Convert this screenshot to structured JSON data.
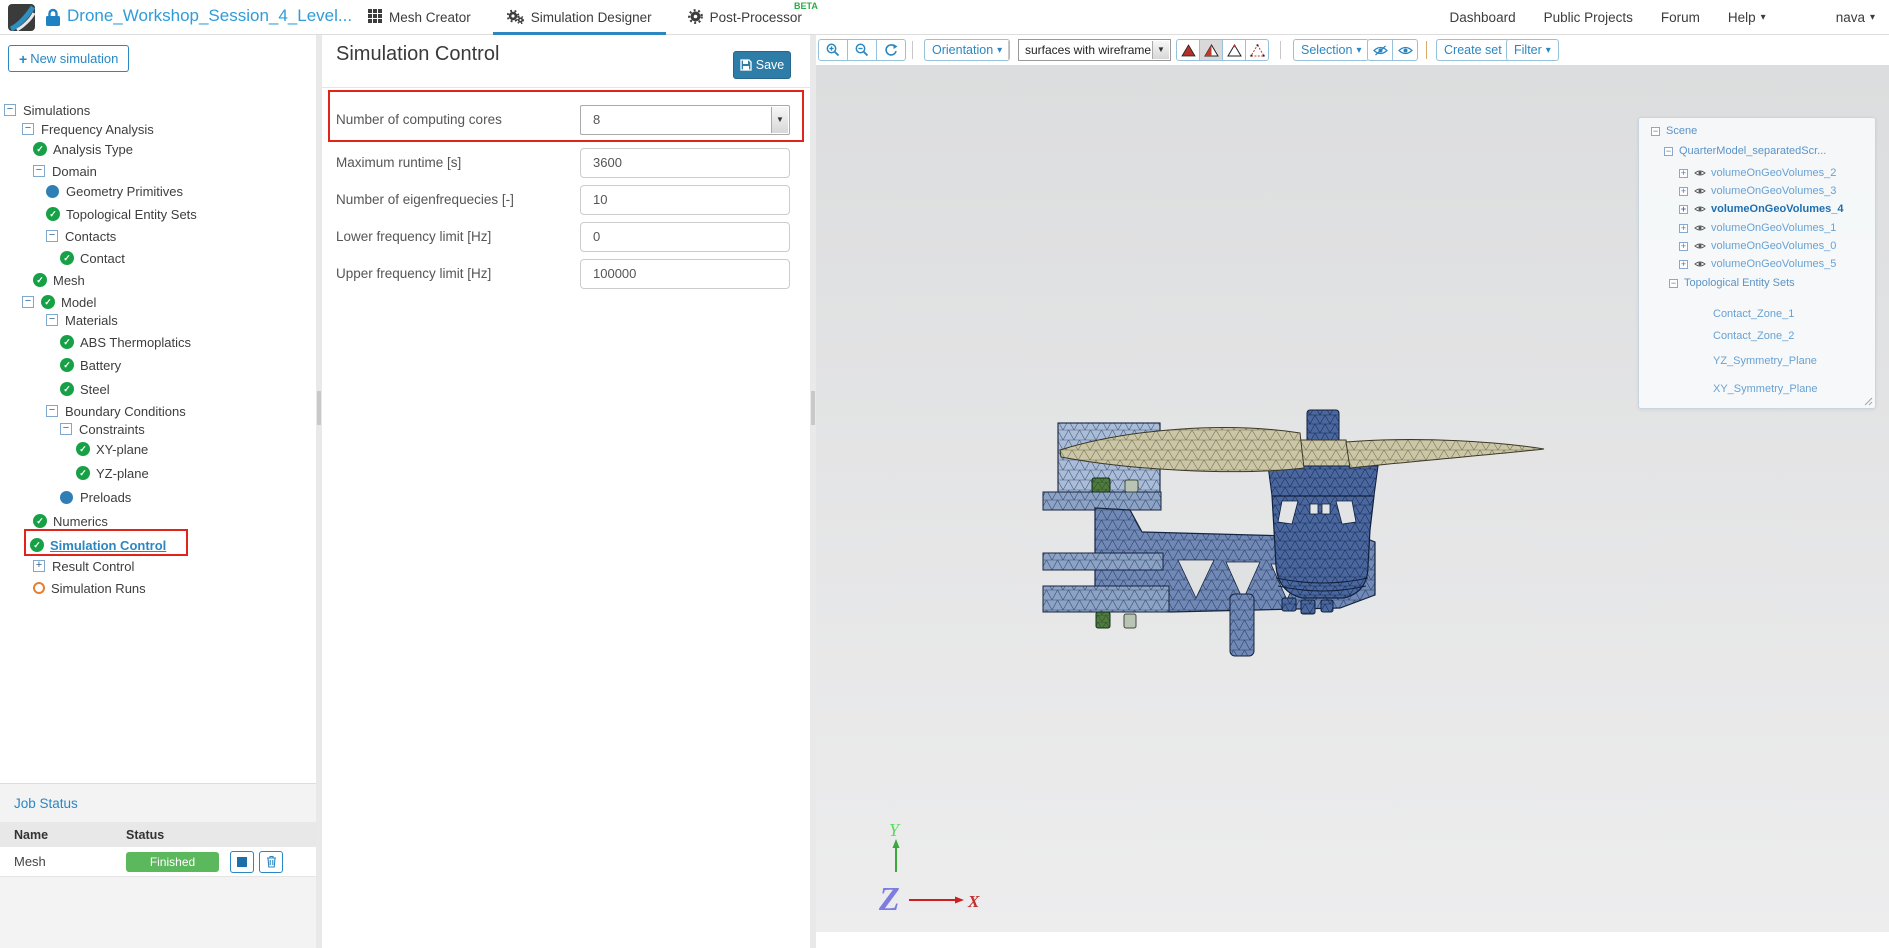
{
  "topbar": {
    "project": "Drone_Workshop_Session_4_Level...",
    "tabs": [
      {
        "label": "Mesh Creator"
      },
      {
        "label": "Simulation Designer",
        "active": true
      },
      {
        "label": "Post-Processor",
        "badge": "BETA"
      }
    ],
    "nav": [
      {
        "label": "Dashboard"
      },
      {
        "label": "Public Projects"
      },
      {
        "label": "Forum"
      },
      {
        "label": "Help"
      }
    ],
    "user": "nava"
  },
  "sidebar": {
    "new_simulation": "New simulation",
    "tree": [
      {
        "label": "Simulations",
        "icon": "collapse"
      },
      {
        "label": "Frequency Analysis",
        "icon": "collapse"
      },
      {
        "label": "Analysis Type",
        "icon": "check-complete"
      },
      {
        "label": "Domain",
        "icon": "collapse"
      },
      {
        "label": "Geometry Primitives",
        "icon": "blue-dot"
      },
      {
        "label": "Topological Entity Sets",
        "icon": "check-complete"
      },
      {
        "label": "Contacts",
        "icon": "collapse"
      },
      {
        "label": "Contact",
        "icon": "check-complete"
      },
      {
        "label": "Mesh",
        "icon": "check-complete"
      },
      {
        "label": "Model",
        "icon": "collapse+check"
      },
      {
        "label": "Materials",
        "icon": "collapse"
      },
      {
        "label": "ABS Thermoplatics",
        "icon": "check-complete"
      },
      {
        "label": "Battery",
        "icon": "check-complete"
      },
      {
        "label": "Steel",
        "icon": "check-complete"
      },
      {
        "label": "Boundary Conditions",
        "icon": "collapse"
      },
      {
        "label": "Constraints",
        "icon": "collapse"
      },
      {
        "label": "XY-plane",
        "icon": "check-complete"
      },
      {
        "label": "YZ-plane",
        "icon": "check-complete"
      },
      {
        "label": "Preloads",
        "icon": "blue-dot"
      },
      {
        "label": "Numerics",
        "icon": "check-complete"
      },
      {
        "label": "Simulation Control",
        "icon": "check-complete",
        "highlighted": true
      },
      {
        "label": "Result Control",
        "icon": "expand"
      },
      {
        "label": "Simulation Runs",
        "icon": "orange-circle"
      }
    ],
    "job_status": {
      "title": "Job Status",
      "col_name": "Name",
      "col_status": "Status",
      "rows": [
        {
          "name": "Mesh",
          "status": "Finished"
        }
      ]
    }
  },
  "panel": {
    "title": "Simulation Control",
    "save": "Save",
    "fields": [
      {
        "label": "Number of computing cores",
        "value": "8",
        "type": "select",
        "highlighted": true
      },
      {
        "label": "Maximum runtime [s]",
        "value": "3600",
        "type": "input"
      },
      {
        "label": "Number of eigenfrequecies [-]",
        "value": "10",
        "type": "input"
      },
      {
        "label": "Lower frequency limit [Hz]",
        "value": "0",
        "type": "input"
      },
      {
        "label": "Upper frequency limit [Hz]",
        "value": "100000",
        "type": "input"
      }
    ]
  },
  "viewport": {
    "toolbar": {
      "orientation": "Orientation",
      "render_mode": "surfaces with wireframe",
      "selection": "Selection",
      "create_set": "Create set",
      "filter": "Filter"
    },
    "scene_tree": {
      "root": "Scene",
      "model": "QuarterModel_separatedScr...",
      "volumes": [
        "volumeOnGeoVolumes_2",
        "volumeOnGeoVolumes_3",
        "volumeOnGeoVolumes_4",
        "volumeOnGeoVolumes_1",
        "volumeOnGeoVolumes_0",
        "volumeOnGeoVolumes_5"
      ],
      "highlighted_volume": "volumeOnGeoVolumes_4",
      "entity_sets_label": "Topological Entity Sets",
      "entity_sets": [
        "Contact_Zone_1",
        "Contact_Zone_2",
        "YZ_Symmetry_Plane",
        "XY_Symmetry_Plane"
      ]
    },
    "axis": {
      "x": "X",
      "y": "Y",
      "z": "Z"
    }
  },
  "colors": {
    "accent_blue": "#2b87c2",
    "save_button": "#2e7da9",
    "finished_green": "#5cb85c",
    "annotation_red": "#e0241a",
    "beta_green": "#27ae45"
  }
}
